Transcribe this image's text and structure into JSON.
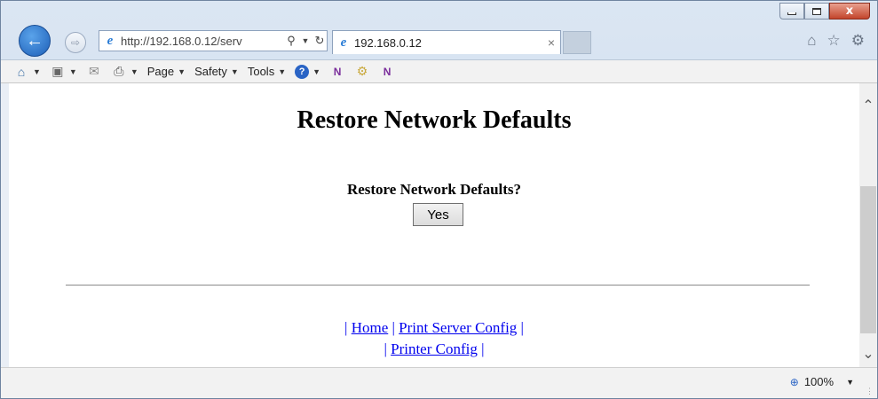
{
  "window": {
    "minimize_label": "",
    "maximize_label": "",
    "close_label": "x"
  },
  "nav": {
    "address_url": "http://192.168.0.12/serv",
    "tab_title": "192.168.0.12",
    "tab_close": "×"
  },
  "commandbar": {
    "page": "Page",
    "safety": "Safety",
    "tools": "Tools"
  },
  "page": {
    "heading": "Restore Network Defaults",
    "question": "Restore Network Defaults?",
    "yes_button": "Yes",
    "links_row1": {
      "sep1": "|",
      "home": "Home",
      "sep2": "|",
      "print_server_config": "Print Server Config",
      "sep3": "|"
    },
    "links_row2": {
      "sep1": "|",
      "printer_config": "Printer Config",
      "sep2": "|"
    }
  },
  "status": {
    "zoom": "100%"
  },
  "colors": {
    "link": "#0000ee",
    "chrome_accent": "#1d5fb8",
    "close_button": "#c3452b"
  }
}
